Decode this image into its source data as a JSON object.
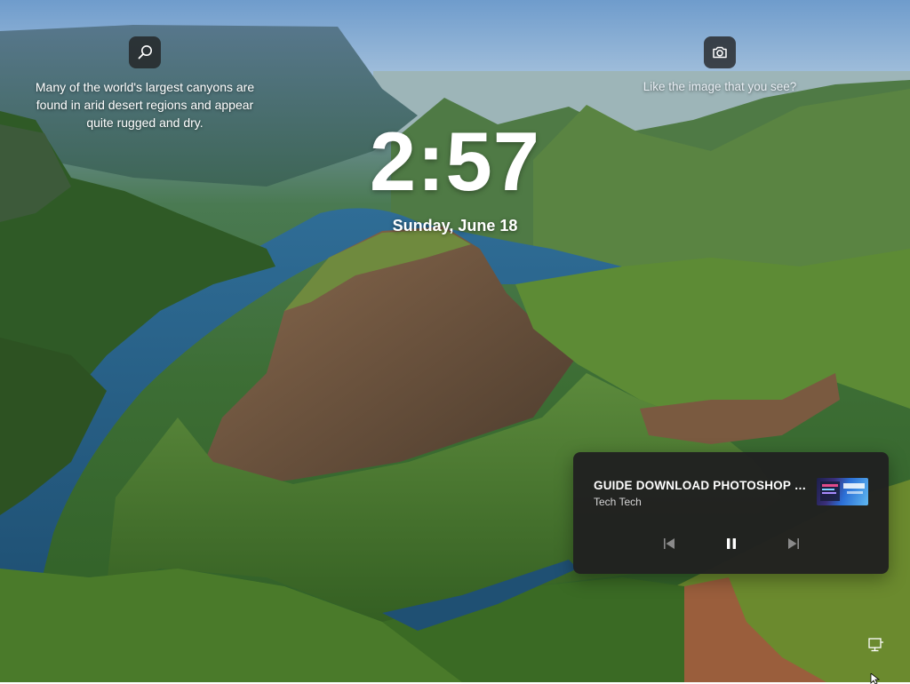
{
  "spotlight": {
    "fact_text": "Many of the world's largest canyons are found in arid desert regions and appear quite rugged and dry.",
    "like_text": "Like the image that you see?",
    "search_icon": "search-icon",
    "camera_icon": "camera-icon"
  },
  "clock": {
    "time": "2:57",
    "date": "Sunday, June 18"
  },
  "media": {
    "title": "GUIDE DOWNLOAD PHOTOSHOP C...",
    "artist": "Tech Tech",
    "controls": {
      "previous_icon": "skip-previous-icon",
      "pause_icon": "pause-icon",
      "next_icon": "skip-next-icon"
    }
  },
  "tray": {
    "network_icon": "network-icon"
  },
  "colors": {
    "card_bg": "#202020",
    "text": "#ffffff",
    "icon_button_bg": "#202020"
  }
}
